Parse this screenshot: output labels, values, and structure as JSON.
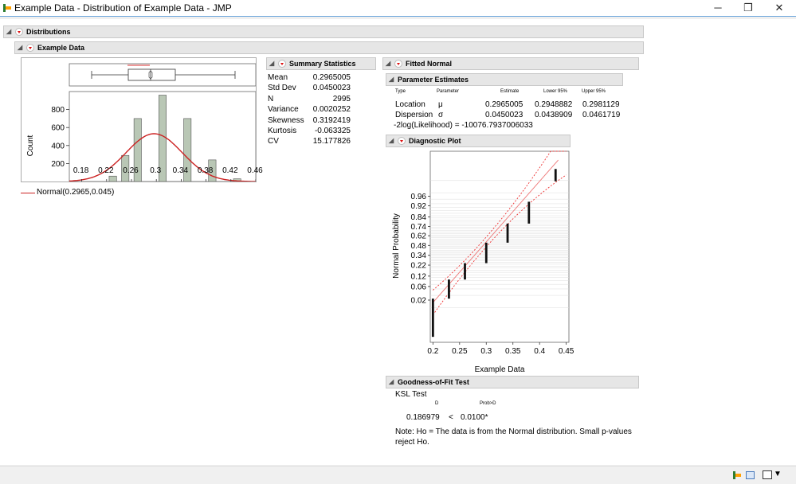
{
  "window": {
    "title": "Example Data - Distribution of Example Data - JMP",
    "minimize": "─",
    "restore": "❐",
    "close": "✕"
  },
  "sections": {
    "distributions": "Distributions",
    "example_data": "Example Data",
    "summary_statistics": "Summary Statistics",
    "fitted_normal": "Fitted Normal",
    "parameter_estimates": "Parameter Estimates",
    "diagnostic_plot": "Diagnostic Plot",
    "goodness_of_fit": "Goodness-of-Fit Test"
  },
  "histogram": {
    "ylabel": "Count",
    "y_ticks": [
      "800",
      "600",
      "400",
      "200"
    ],
    "x_ticks": [
      "0.18",
      "0.22",
      "0.26",
      "0.3",
      "0.34",
      "0.38",
      "0.42",
      "0.46"
    ],
    "legend": "Normal(0.2965,0.045)"
  },
  "summary_statistics": {
    "rows": [
      {
        "label": "Mean",
        "value": "0.2965005"
      },
      {
        "label": "Std Dev",
        "value": "0.0450023"
      },
      {
        "label": "N",
        "value": "2995"
      },
      {
        "label": "Variance",
        "value": "0.0020252"
      },
      {
        "label": "Skewness",
        "value": "0.3192419"
      },
      {
        "label": "Kurtosis",
        "value": "-0.063325"
      },
      {
        "label": "CV",
        "value": "15.177826"
      }
    ]
  },
  "parameter_estimates": {
    "headers": [
      "Type",
      "Parameter",
      "Estimate",
      "Lower 95%",
      "Upper 95%"
    ],
    "rows": [
      {
        "type": "Location",
        "param": "μ",
        "estimate": "0.2965005",
        "lower": "0.2948882",
        "upper": "0.2981129"
      },
      {
        "type": "Dispersion",
        "param": "σ",
        "estimate": "0.0450023",
        "lower": "0.0438909",
        "upper": "0.0461719"
      }
    ],
    "likelihood": "-2log(Likelihood) = -10076.7937006033"
  },
  "diagnostic_plot": {
    "ylabel": "Normal Probability",
    "xlabel": "Example Data",
    "y_ticks": [
      "0.96",
      "0.92",
      "0.84",
      "0.74",
      "0.62",
      "0.48",
      "0.34",
      "0.22",
      "0.12",
      "0.06",
      "0.02"
    ],
    "x_ticks": [
      "0.2",
      "0.25",
      "0.3",
      "0.35",
      "0.4",
      "0.45"
    ]
  },
  "goodness_of_fit": {
    "test_name": "KSL Test",
    "col_d": "D",
    "col_prob": "Prob>D",
    "d_value": "0.186979",
    "op": "<",
    "p_value": "0.0100*",
    "note_line1": "Note: Ho = The data is from the Normal distribution. Small p-values",
    "note_line2": "reject Ho."
  },
  "chart_data": [
    {
      "type": "bar",
      "ylabel": "Count",
      "x_range": [
        0.16,
        0.46
      ],
      "ylim": [
        0,
        1000
      ],
      "bin_centers": [
        0.21,
        0.23,
        0.25,
        0.27,
        0.29,
        0.31,
        0.33,
        0.35,
        0.37,
        0.39,
        0.41,
        0.43,
        0.45
      ],
      "values": [
        0,
        60,
        290,
        700,
        0,
        960,
        0,
        700,
        0,
        240,
        0,
        30,
        0
      ],
      "overlay": {
        "type": "line",
        "distribution": "Normal",
        "mean": 0.2965,
        "sd": 0.045,
        "color": "#cc2222"
      },
      "bar_color": "#b9c7b5"
    },
    {
      "type": "scatter",
      "xlabel": "Example Data",
      "ylabel": "Normal Probability",
      "xlim": [
        0.195,
        0.455
      ],
      "x_clusters": [
        0.2,
        0.23,
        0.26,
        0.3,
        0.34,
        0.38,
        0.43
      ],
      "fit_line_color": "#ee7777",
      "confidence_band_color": "#ee3333"
    }
  ]
}
